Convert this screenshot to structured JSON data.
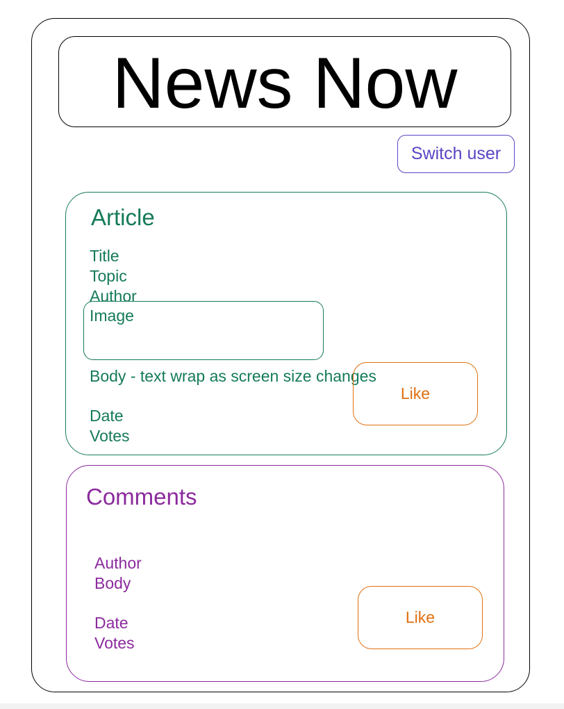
{
  "header": {
    "title": "News Now",
    "switch_user_label": "Switch user"
  },
  "article": {
    "heading": "Article",
    "title_label": "Title",
    "topic_label": "Topic",
    "author_label": "Author",
    "image_label": "Image",
    "body_label": "Body - text wrap as screen size changes",
    "date_label": "Date",
    "votes_label": "Votes",
    "like_label": "Like"
  },
  "comments": {
    "heading": "Comments",
    "author_label": "Author",
    "body_label": "Body",
    "date_label": "Date",
    "votes_label": "Votes",
    "like_label": "Like"
  },
  "colors": {
    "article": "#157a5a",
    "comments": "#8b2a9d",
    "like": "#e07010",
    "switch_user": "#5a44c4",
    "outline": "#000000"
  }
}
